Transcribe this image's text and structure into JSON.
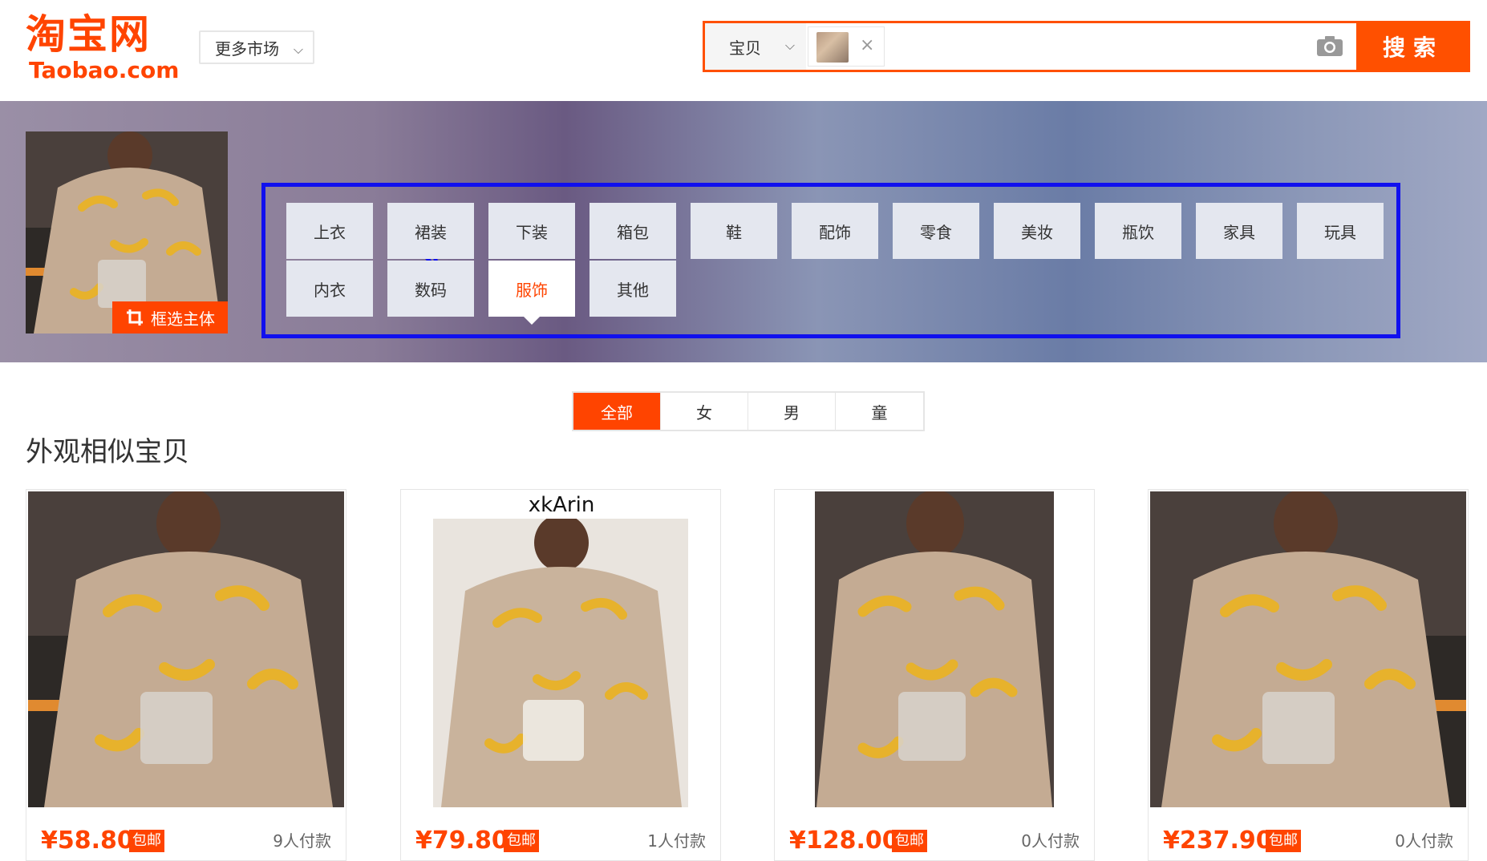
{
  "header": {
    "logo_cn": "淘宝网",
    "logo_en": "Taobao.com",
    "more_market": "更多市场",
    "search_type": "宝贝",
    "search_placeholder": "",
    "search_button": "搜索"
  },
  "banner": {
    "crop_button": "框选主体",
    "categories": [
      {
        "label": "上衣"
      },
      {
        "label": "裙装"
      },
      {
        "label": "下装"
      },
      {
        "label": "箱包"
      },
      {
        "label": "鞋"
      },
      {
        "label": "配饰"
      },
      {
        "label": "零食"
      },
      {
        "label": "美妆"
      },
      {
        "label": "瓶饮"
      },
      {
        "label": "家具"
      },
      {
        "label": "玩具"
      },
      {
        "label": "内衣"
      },
      {
        "label": "数码"
      },
      {
        "label": "服饰",
        "active": true
      },
      {
        "label": "其他"
      }
    ]
  },
  "filters": {
    "tabs": [
      {
        "label": "全部",
        "active": true
      },
      {
        "label": "女"
      },
      {
        "label": "男"
      },
      {
        "label": "童"
      }
    ]
  },
  "results": {
    "title": "外观相似宝贝",
    "free_ship_label": "包邮",
    "items": [
      {
        "price": "¥58.80",
        "payers": "9人付款",
        "caption": ""
      },
      {
        "price": "¥79.80",
        "payers": "1人付款",
        "caption": "xkArin"
      },
      {
        "price": "¥128.00",
        "payers": "0人付款",
        "caption": ""
      },
      {
        "price": "¥237.90",
        "payers": "0人付款",
        "caption": ""
      }
    ]
  },
  "colors": {
    "brand": "#ff4400",
    "search_border": "#ff5000",
    "highlight_box": "#1010ee"
  },
  "icons": [
    "chevron-down-icon",
    "close-icon",
    "camera-icon",
    "crop-icon",
    "arrow-annotation-icon"
  ]
}
